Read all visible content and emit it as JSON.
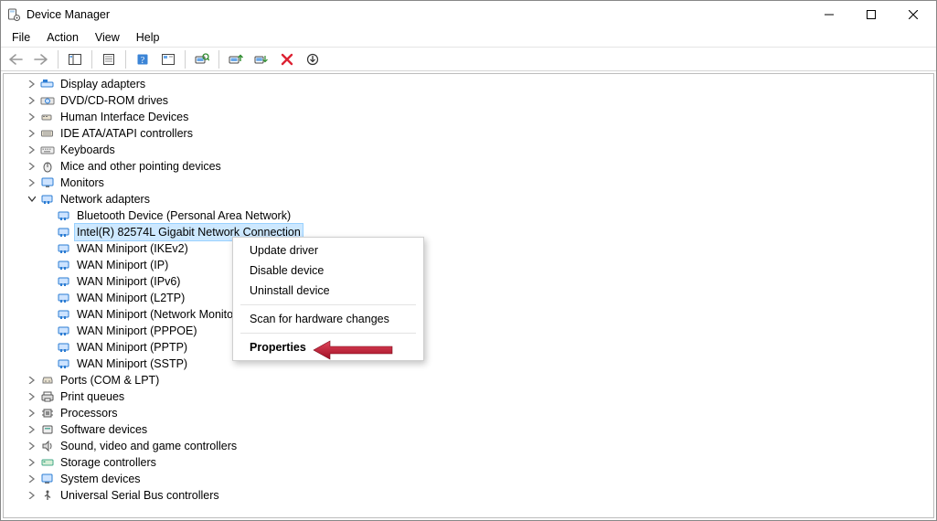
{
  "window": {
    "title": "Device Manager"
  },
  "menu": {
    "file": "File",
    "action": "Action",
    "view": "View",
    "help": "Help"
  },
  "tree": {
    "display_adapters": "Display adapters",
    "dvd": "DVD/CD-ROM drives",
    "hid": "Human Interface Devices",
    "ide": "IDE ATA/ATAPI controllers",
    "keyboards": "Keyboards",
    "mice": "Mice and other pointing devices",
    "monitors": "Monitors",
    "network_adapters": "Network adapters",
    "net": {
      "bt": "Bluetooth Device (Personal Area Network)",
      "intel": "Intel(R) 82574L Gigabit Network Connection",
      "ikev2": "WAN Miniport (IKEv2)",
      "ip": "WAN Miniport (IP)",
      "ipv6": "WAN Miniport (IPv6)",
      "l2tp": "WAN Miniport (L2TP)",
      "netmon": "WAN Miniport (Network Monitor)",
      "pppoe": "WAN Miniport (PPPOE)",
      "pptp": "WAN Miniport (PPTP)",
      "sstp": "WAN Miniport (SSTP)"
    },
    "ports": "Ports (COM & LPT)",
    "print_queues": "Print queues",
    "processors": "Processors",
    "software_devices": "Software devices",
    "sound": "Sound, video and game controllers",
    "storage": "Storage controllers",
    "system_devices": "System devices",
    "usb": "Universal Serial Bus controllers"
  },
  "context_menu": {
    "update": "Update driver",
    "disable": "Disable device",
    "uninstall": "Uninstall device",
    "scan": "Scan for hardware changes",
    "properties": "Properties"
  }
}
